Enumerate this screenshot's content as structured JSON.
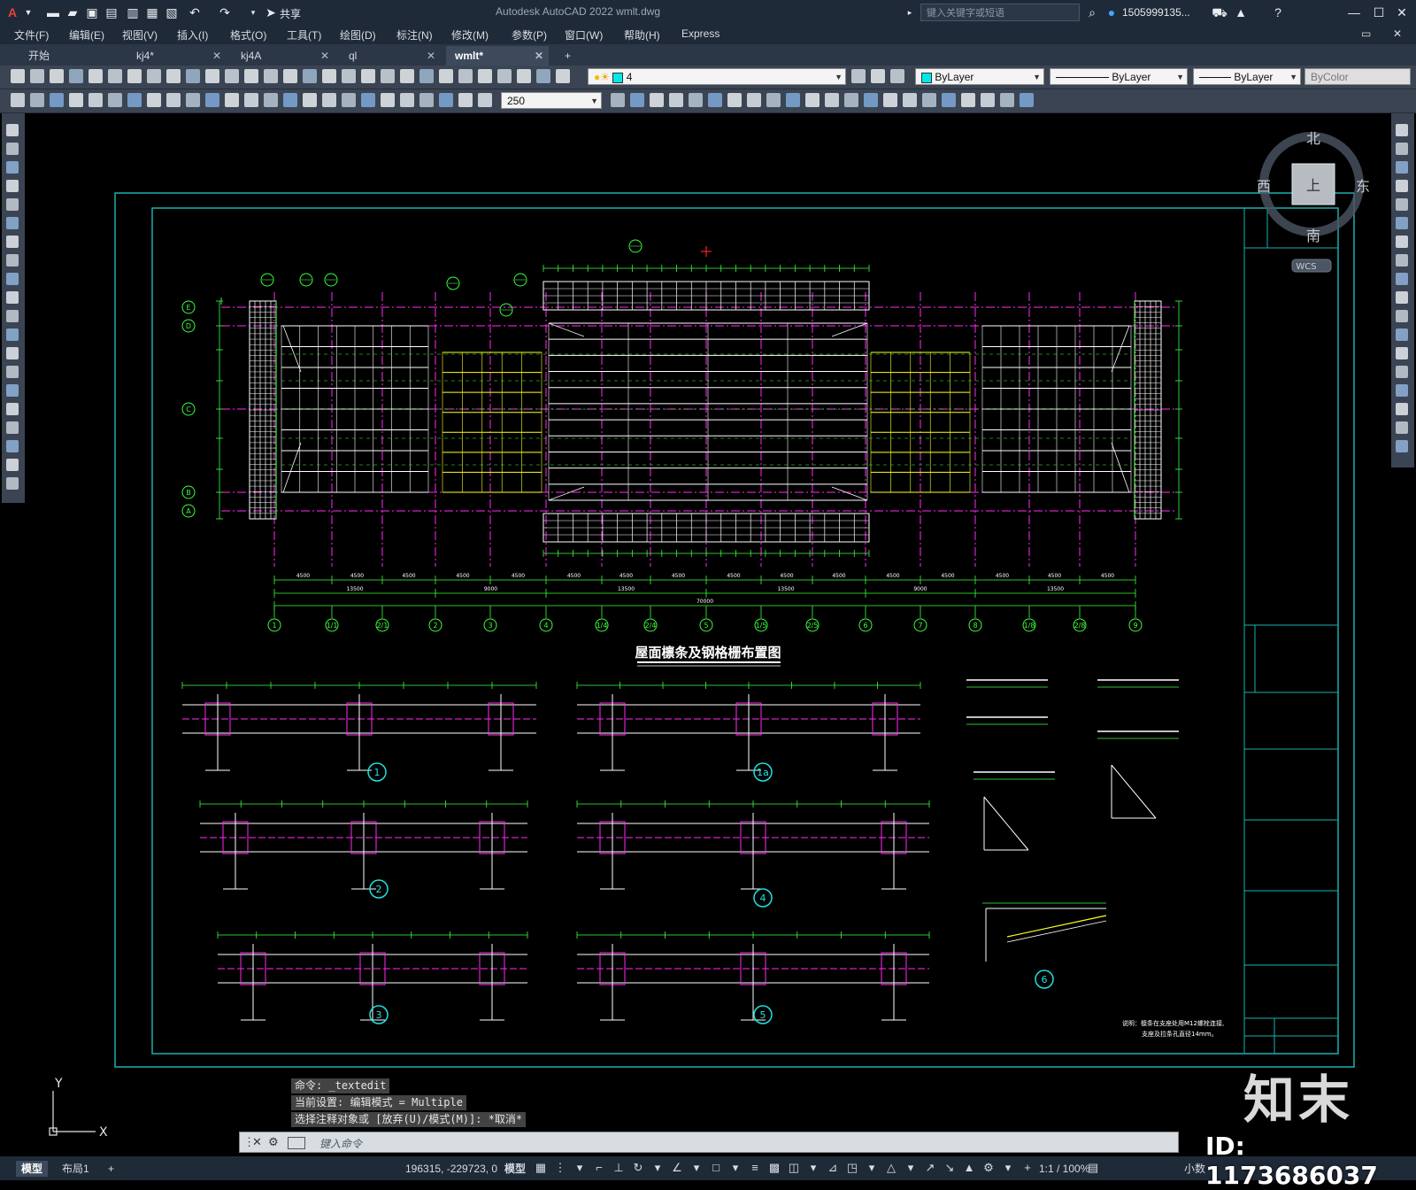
{
  "titlebar": {
    "app_logo": "A",
    "app_title": "Autodesk AutoCAD 2022    wmlt.dwg",
    "share_label": "共享",
    "search_placeholder": "键入关键字或短语",
    "user_name": "1505999135...",
    "icons": [
      "new-icon",
      "open-icon",
      "save-icon",
      "saveas-icon",
      "open-web-icon",
      "save-web-icon",
      "plot-icon",
      "undo-icon",
      "redo-icon",
      "share-icon",
      "search-icon",
      "user-icon",
      "cart-icon",
      "a360-icon",
      "help-icon",
      "minimize-icon",
      "maximize-icon",
      "close-icon"
    ]
  },
  "menubar": {
    "items": [
      "文件(F)",
      "编辑(E)",
      "视图(V)",
      "插入(I)",
      "格式(O)",
      "工具(T)",
      "绘图(D)",
      "标注(N)",
      "修改(M)",
      "参数(P)",
      "窗口(W)",
      "帮助(H)",
      "Express"
    ]
  },
  "tabs": {
    "items": [
      {
        "label": "开始",
        "active": false
      },
      {
        "label": "kj4*",
        "active": false
      },
      {
        "label": "kj4A",
        "active": false
      },
      {
        "label": "ql",
        "active": false
      },
      {
        "label": "wmlt*",
        "active": true
      }
    ],
    "add_label": "+"
  },
  "toolbar1": {
    "layer_value": "4",
    "color_value": "ByLayer",
    "linetype_value": "ByLayer",
    "lineweight_value": "ByLayer",
    "plotstyle_value": "ByColor"
  },
  "toolbar2": {
    "dim_scale_value": "250"
  },
  "viewcube": {
    "north": "北",
    "south": "南",
    "east": "东",
    "west": "西",
    "face": "上",
    "wcs": "WCS"
  },
  "drawing": {
    "main_title": "屋面檩条及钢格栅布置图",
    "grid_rows": [
      "E",
      "D",
      "C",
      "B",
      "A"
    ],
    "grid_cols": [
      "1",
      "1/1",
      "2/1",
      "2",
      "3",
      "4",
      "1/4",
      "2/4",
      "5",
      "1/5",
      "2/5",
      "6",
      "7",
      "8",
      "1/8",
      "2/8",
      "9"
    ],
    "dims_bottom": [
      "4500",
      "4500",
      "4500",
      "4500",
      "4500",
      "4500",
      "4500",
      "4500",
      "4500",
      "4500",
      "4500",
      "4500",
      "4500",
      "4500",
      "4500",
      "4500"
    ],
    "dims_mid": [
      "13500",
      "9000",
      "13500",
      "13500",
      "9000",
      "13500"
    ],
    "dims_total": "70000",
    "detail_labels": [
      "1",
      "1a",
      "2",
      "3",
      "4",
      "5",
      "6"
    ],
    "notes": [
      "说明：檩条在支座处用M12螺栓连接,",
      "支座及拉条孔直径14mm。"
    ]
  },
  "ucs": {
    "x": "X",
    "y": "Y"
  },
  "command": {
    "history": [
      "命令: _textedit",
      "当前设置: 编辑模式 = Multiple",
      "选择注释对象或 [放弃(U)/模式(M)]: *取消*"
    ],
    "placeholder": "键入命令"
  },
  "statusbar": {
    "tabs": [
      {
        "label": "模型",
        "active": true
      },
      {
        "label": "布局1",
        "active": false
      }
    ],
    "add_label": "+",
    "coordinates": "196315, -229723, 0",
    "mode_label": "模型",
    "scale_label": "1:1 / 100%",
    "units_label": "小数"
  },
  "watermark": {
    "logo": "知末",
    "id": "ID: 1173686037"
  },
  "colors": {
    "cad_bg": "#000000",
    "frame": "#1ab0b0",
    "magenta": "#ff2cf0",
    "green": "#3cff3c",
    "white": "#ffffff",
    "yellow": "#ffff20",
    "red": "#ff2020"
  }
}
